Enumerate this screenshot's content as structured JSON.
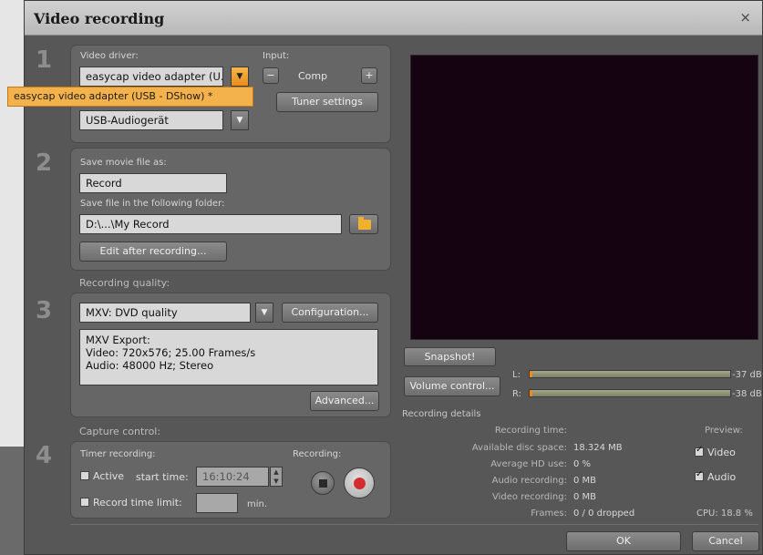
{
  "dialog": {
    "title": "Video recording",
    "close_label": "×"
  },
  "section_numbers": [
    "1",
    "2",
    "3",
    "4"
  ],
  "section1": {
    "video_driver_label": "Video driver:",
    "video_driver_value": "easycap video adapter (U...",
    "dropdown_option": "easycap video adapter (USB - DShow) *",
    "input_label": "Input:",
    "input_minus": "−",
    "input_value": "Comp",
    "input_plus": "+",
    "tuner_settings": "Tuner settings",
    "audio_device_value": "USB-Audiogerät"
  },
  "section2": {
    "save_as_label": "Save movie file as:",
    "save_as_value": "Record",
    "folder_label": "Save file in the following folder:",
    "folder_value": "D:\\...\\My Record",
    "edit_after": "Edit after recording..."
  },
  "section3": {
    "quality_label": "Recording quality:",
    "quality_value": "MXV: DVD quality",
    "configuration": "Configuration...",
    "info_lines": [
      "MXV Export:",
      "Video: 720x576; 25.00 Frames/s",
      "Audio: 48000 Hz; Stereo"
    ],
    "advanced": "Advanced..."
  },
  "section4": {
    "capture_label": "Capture control:",
    "timer_label": "Timer recording:",
    "recording_label": "Recording:",
    "active_label": "Active",
    "start_time_label": "start time:",
    "start_time_value": "16:10:24",
    "limit_label": "Record time limit:",
    "limit_unit": "min."
  },
  "preview_panel": {
    "snapshot": "Snapshot!",
    "volume_control": "Volume control...",
    "meter_left_label": "L:",
    "meter_left_db": "-37 dB",
    "meter_right_label": "R:",
    "meter_right_db": "-38 dB"
  },
  "details": {
    "heading": "Recording details",
    "rows": [
      {
        "label": "Recording time:",
        "value": ""
      },
      {
        "label": "Available disc space:",
        "value": "18.324 MB"
      },
      {
        "label": "Average HD use:",
        "value": "0 %"
      },
      {
        "label": "Audio recording:",
        "value": "0 MB"
      },
      {
        "label": "Video recording:",
        "value": "0 MB"
      },
      {
        "label": "Frames:",
        "value": "0 / 0 dropped"
      }
    ],
    "preview_label": "Preview:",
    "video_check": "Video",
    "audio_check": "Audio",
    "cpu": "CPU:  18.8 %"
  },
  "footer": {
    "ok": "OK",
    "cancel": "Cancel"
  },
  "colors": {
    "dialog_bg": "#575757",
    "accent_orange": "#f3b24c",
    "record_red": "#d32f2f",
    "preview_bg": "#160312"
  },
  "icons": [
    "close-icon",
    "chevron-down-icon",
    "minus-icon",
    "plus-icon",
    "folder-icon",
    "stop-icon",
    "record-icon",
    "checkbox-icon"
  ]
}
